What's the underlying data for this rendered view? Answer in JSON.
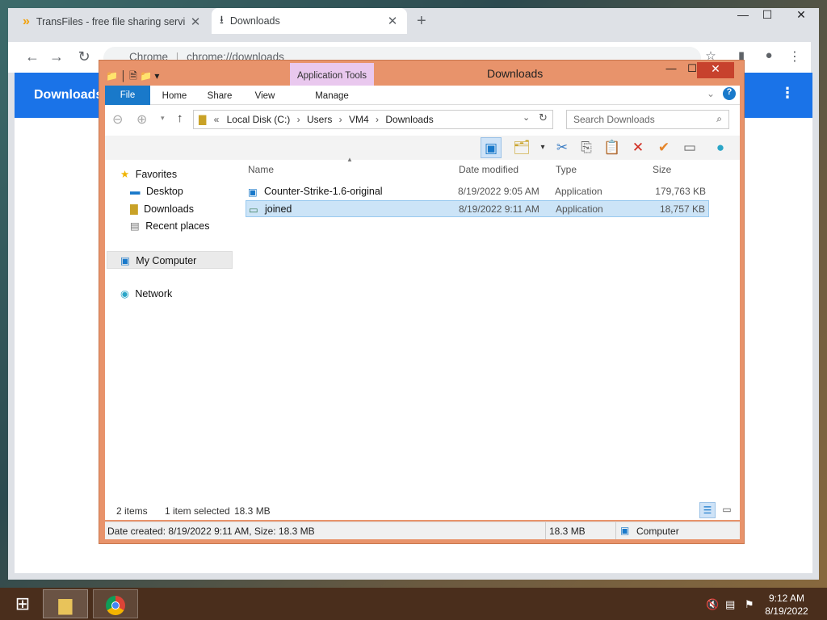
{
  "browser": {
    "tabs": [
      {
        "title": "TransFiles - free file sharing servi",
        "icon": "transfiles-icon"
      },
      {
        "title": "Downloads",
        "icon": "download-icon"
      }
    ],
    "address_scheme": "Chrome",
    "address_url": "chrome://downloads",
    "page_title": "Downloads"
  },
  "explorer": {
    "window_title": "Downloads",
    "contextual_tab": "Application Tools",
    "ribbon_tabs": [
      "File",
      "Home",
      "Share",
      "View",
      "Manage"
    ],
    "address": {
      "overflow": "«",
      "crumbs": [
        "Local Disk (C:)",
        "Users",
        "VM4",
        "Downloads"
      ]
    },
    "search_placeholder": "Search Downloads",
    "nav": {
      "favorites": "Favorites",
      "favorites_items": [
        "Desktop",
        "Downloads",
        "Recent places"
      ],
      "computer": "My Computer",
      "network": "Network"
    },
    "columns": [
      "Name",
      "Date modified",
      "Type",
      "Size"
    ],
    "files": [
      {
        "name": "Counter-Strike-1.6-original",
        "date": "8/19/2022 9:05 AM",
        "type": "Application",
        "size": "179,763 KB",
        "selected": false
      },
      {
        "name": "joined",
        "date": "8/19/2022 9:11 AM",
        "type": "Application",
        "size": "18,757 KB",
        "selected": true
      }
    ],
    "status": {
      "count": "2 items",
      "selection": "1 item selected",
      "selection_size": "18.3 MB"
    },
    "details": {
      "info": "Date created: 8/19/2022 9:11 AM, Size: 18.3 MB",
      "size": "18.3 MB",
      "location": "Computer"
    }
  },
  "taskbar": {
    "time": "9:12 AM",
    "date": "8/19/2022"
  },
  "colors": {
    "chrome_blue": "#1a73e8",
    "explorer_frame": "#e8936b",
    "selection": "#cce4f7",
    "file_tab": "#1979ca"
  }
}
